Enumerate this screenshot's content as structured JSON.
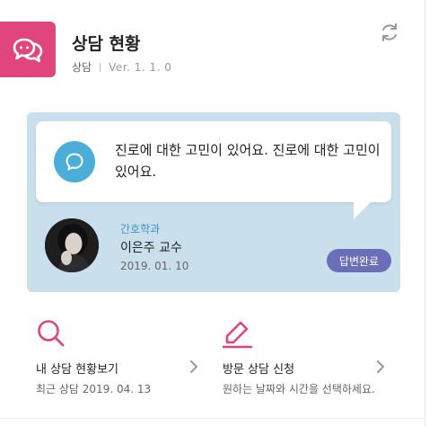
{
  "app": {
    "title": "상담 현황",
    "category": "상담",
    "version": "Ver. 1. 1. 0",
    "icon": "chat-bubbles-icon",
    "accent": "#e0457b"
  },
  "toolbar": {
    "refresh_icon": "refresh-icon"
  },
  "consult": {
    "question": "진로에 대한 고민이 있어요. 진로에 대한 고민이 있어요.",
    "question_icon": "chat-bubble-icon",
    "department": "간호학과",
    "professor": "이은주 교수",
    "date": "2019. 01. 10",
    "status": "답변완료",
    "card_color": "#c9e0ec",
    "status_color": "#6a6fb8"
  },
  "actions": [
    {
      "icon": "search-icon",
      "label": "내 상담 현황보기",
      "sub": "최근 상담 2019. 04. 13"
    },
    {
      "icon": "pencil-icon",
      "label": "방문 상담 신청",
      "sub": "원하는 날짜와 시간을 선택하세요."
    }
  ]
}
